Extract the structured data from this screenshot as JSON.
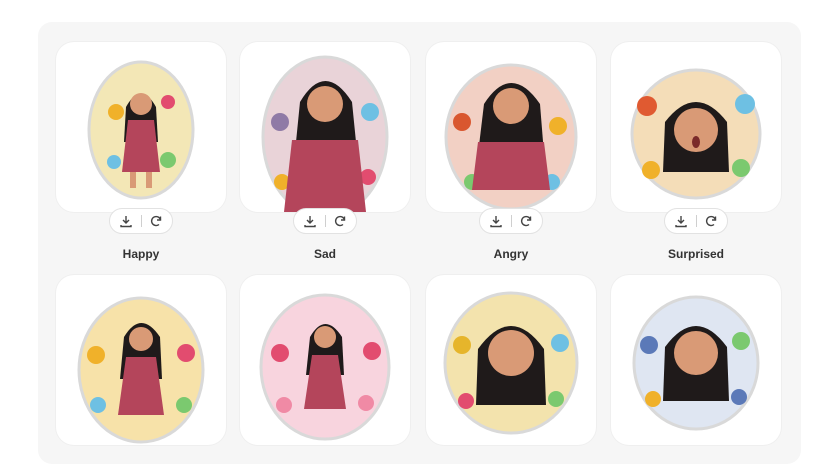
{
  "stickers": [
    {
      "label": "Happy",
      "bg": "#f3e7b6",
      "accent": "#e8a24a"
    },
    {
      "label": "Sad",
      "bg": "#e9d3d8",
      "accent": "#8f7aa6"
    },
    {
      "label": "Angry",
      "bg": "#f2d0c4",
      "accent": "#d9572f"
    },
    {
      "label": "Surprised",
      "bg": "#f4ddb8",
      "accent": "#e05a31"
    },
    {
      "label": "",
      "bg": "#f7e2a9",
      "accent": "#f0b12a"
    },
    {
      "label": "",
      "bg": "#f8d4de",
      "accent": "#e24c6f"
    },
    {
      "label": "",
      "bg": "#f3e3ad",
      "accent": "#e6b52b"
    },
    {
      "label": "",
      "bg": "#dfe6f2",
      "accent": "#5b79b8"
    }
  ],
  "actions": {
    "download_icon": "download-icon",
    "regenerate_icon": "regenerate-icon"
  },
  "colors": {
    "panel": "#f6f6f6",
    "card": "#ffffff",
    "dress": "#b4455b",
    "hair": "#1f1a1a",
    "skin": "#d99a76"
  }
}
